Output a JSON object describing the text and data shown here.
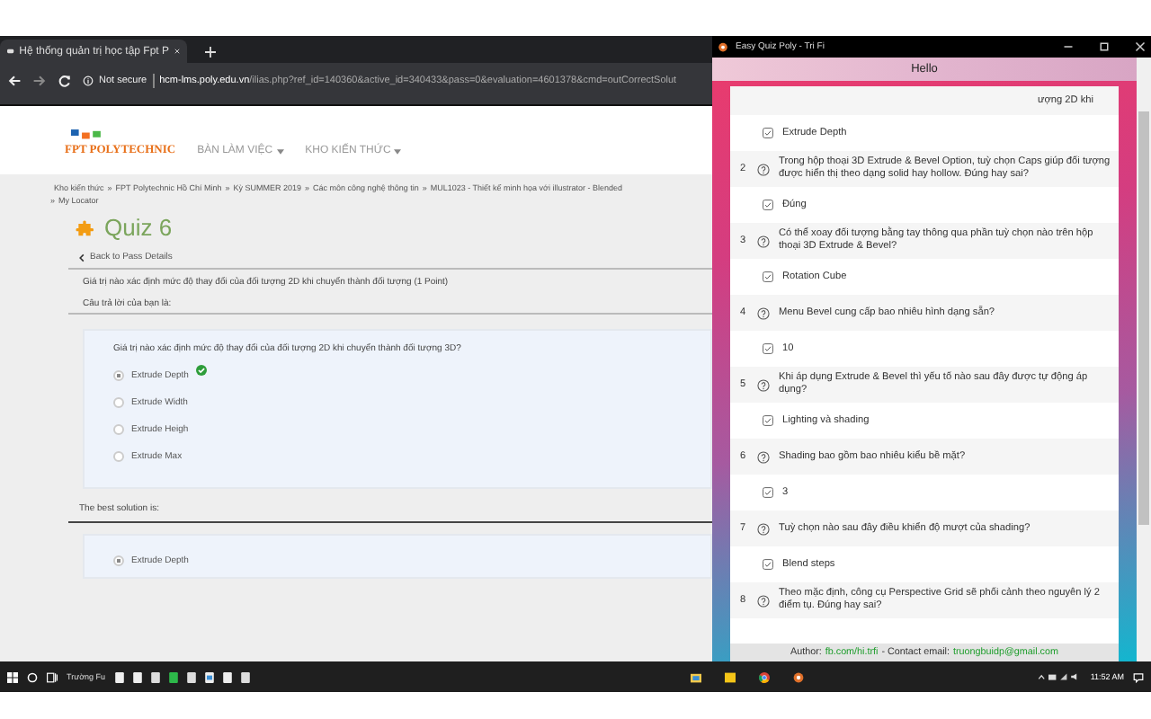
{
  "browser": {
    "tab_title": "Hệ thống quản trị học tập Fpt P",
    "security": "Not secure",
    "host": "hcm-lms.poly.edu.vn",
    "path": "/ilias.php?ref_id=140360&active_id=340433&pass=0&evaluation=4601378&cmd=outCorrectSolut"
  },
  "site": {
    "logo": "FPT POLYTECHNIC",
    "menu": [
      "BÀN LÀM VIỆC",
      "KHO KIẾN THỨC"
    ],
    "breadcrumb": [
      {
        "label": "Kho kiến thức",
        "separator": "»"
      },
      {
        "label": "FPT Polytechnic Hồ Chí Minh",
        "separator": "»"
      },
      {
        "label": "Kỳ SUMMER 2019",
        "separator": "»"
      },
      {
        "label": "Các môn công nghệ thông tin",
        "separator": "»"
      },
      {
        "label": "MUL1023 - Thiết kế minh họa với illustrator - Blended"
      }
    ],
    "locator": {
      "separator": "»",
      "label": "My Locator"
    },
    "title": "Quiz 6",
    "back_link": "Back to Pass Details",
    "question_title": "Giá trị nào xác định mức độ thay đổi của đối tượng 2D khi chuyển thành đối tượng (1 Point)",
    "answer_label": "Câu trả lời của bạn là:",
    "question": "Giá trị nào xác định mức độ thay đổi của đối tượng 2D khi chuyển thành đối tượng 3D?",
    "options": [
      {
        "label": "Extrude Depth",
        "selected": true,
        "correct": true
      },
      {
        "label": "Extrude Width",
        "selected": false,
        "correct": false
      },
      {
        "label": "Extrude Heigh",
        "selected": false,
        "correct": false
      },
      {
        "label": "Extrude Max",
        "selected": false,
        "correct": false
      }
    ],
    "best_label": "The best solution is:",
    "best_options": [
      {
        "label": "Extrude Depth",
        "selected": true
      }
    ]
  },
  "popup": {
    "title": "Easy Quiz Poly - Tri Fi",
    "header": "Hello",
    "items": [
      {
        "kind": "fragment",
        "text": "ượng 2D khi"
      },
      {
        "kind": "answer",
        "text": "Extrude Depth",
        "checked": true
      },
      {
        "kind": "question",
        "number": "2",
        "text": "Trong hộp thoại 3D Extrude & Bevel Option, tuỳ chọn Caps giúp đối tượng được hiển thị theo dạng solid hay hollow. Đúng hay sai?"
      },
      {
        "kind": "answer",
        "text": "Đúng",
        "checked": true
      },
      {
        "kind": "question",
        "number": "3",
        "text": "Có thể xoay đối tượng bằng tay thông qua phần tuỳ chọn nào trên hộp thoại 3D Extrude & Bevel?"
      },
      {
        "kind": "answer",
        "text": "Rotation Cube",
        "checked": true
      },
      {
        "kind": "question",
        "number": "4",
        "text": "Menu Bevel cung cấp bao nhiêu hình dạng sẵn?"
      },
      {
        "kind": "answer",
        "text": "10",
        "checked": true
      },
      {
        "kind": "question",
        "number": "5",
        "text": "Khi áp dụng Extrude & Bevel thì yếu tố nào sau đây được tự động áp dụng?"
      },
      {
        "kind": "answer",
        "text": "Lighting và shading",
        "checked": true
      },
      {
        "kind": "question",
        "number": "6",
        "text": "Shading bao gồm bao nhiêu kiểu bề mặt?"
      },
      {
        "kind": "answer",
        "text": "3",
        "checked": true
      },
      {
        "kind": "question",
        "number": "7",
        "text": "Tuỳ chọn nào sau đây điều khiển độ mượt của shading?"
      },
      {
        "kind": "answer",
        "text": "Blend steps",
        "checked": true
      },
      {
        "kind": "question",
        "number": "8",
        "text": "Theo mặc định, công cụ Perspective Grid sẽ phối cảnh theo nguyên lý 2 điểm tụ. Đúng hay sai?"
      }
    ],
    "footer": {
      "author_label": "Author:",
      "author_link": "fb.com/hi.trfi",
      "contact_label": "- Contact email:",
      "email": "truongbuidp@gmail.com"
    }
  },
  "taskbar": {
    "app_label": "Trường Fu",
    "time": "11:52 AM"
  }
}
